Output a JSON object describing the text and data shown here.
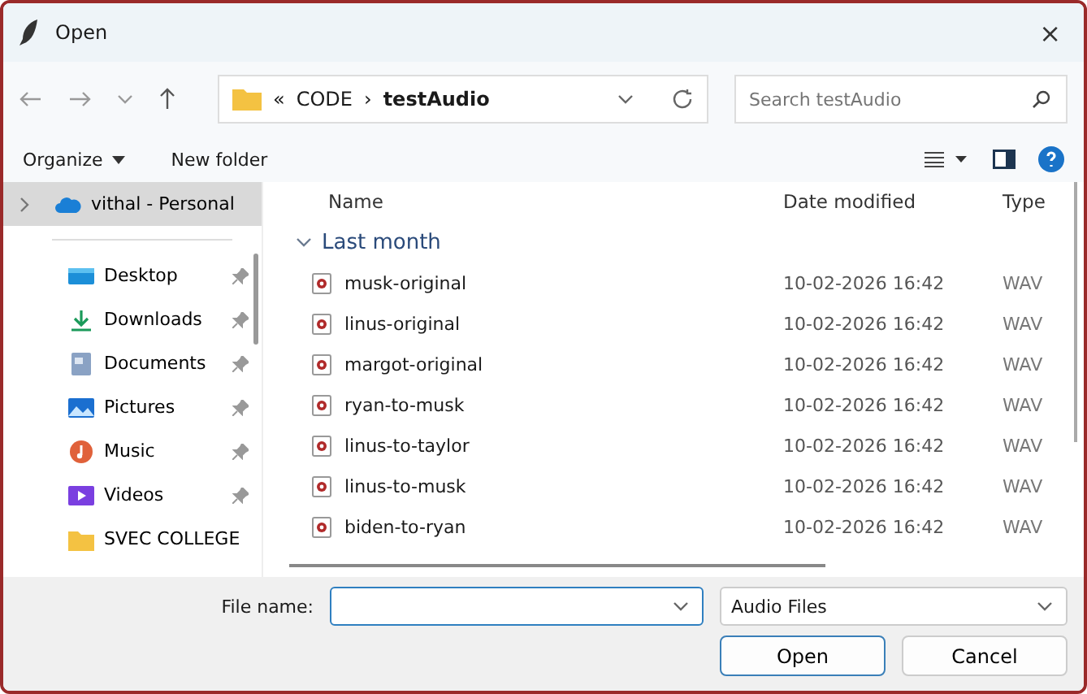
{
  "window": {
    "title": "Open",
    "close": "×"
  },
  "address": {
    "crumbs": [
      "«",
      "CODE",
      "›",
      "testAudio"
    ]
  },
  "search": {
    "placeholder": "Search testAudio"
  },
  "toolbar": {
    "organize": "Organize",
    "new_folder": "New folder"
  },
  "sidebar": {
    "items": [
      {
        "label": "vithal - Personal",
        "kind": "cloud",
        "selected": true,
        "pinned": false
      },
      {
        "label": "Desktop",
        "kind": "desktop",
        "selected": false,
        "pinned": true
      },
      {
        "label": "Downloads",
        "kind": "downloads",
        "selected": false,
        "pinned": true
      },
      {
        "label": "Documents",
        "kind": "documents",
        "selected": false,
        "pinned": true
      },
      {
        "label": "Pictures",
        "kind": "pictures",
        "selected": false,
        "pinned": true
      },
      {
        "label": "Music",
        "kind": "music",
        "selected": false,
        "pinned": true
      },
      {
        "label": "Videos",
        "kind": "videos",
        "selected": false,
        "pinned": true
      },
      {
        "label": "SVEC COLLEGE",
        "kind": "folder",
        "selected": false,
        "pinned": false
      }
    ]
  },
  "table": {
    "columns": [
      "Name",
      "Date modified",
      "Type"
    ],
    "group": {
      "label": "Last month",
      "expanded": true
    },
    "rows": [
      {
        "name": "musk-original",
        "date": "10-02-2026 16:42",
        "type": "WAV"
      },
      {
        "name": "linus-original",
        "date": "10-02-2026 16:42",
        "type": "WAV"
      },
      {
        "name": "margot-original",
        "date": "10-02-2026 16:42",
        "type": "WAV"
      },
      {
        "name": "ryan-to-musk",
        "date": "10-02-2026 16:42",
        "type": "WAV"
      },
      {
        "name": "linus-to-taylor",
        "date": "10-02-2026 16:42",
        "type": "WAV"
      },
      {
        "name": "linus-to-musk",
        "date": "10-02-2026 16:42",
        "type": "WAV"
      },
      {
        "name": "biden-to-ryan",
        "date": "10-02-2026 16:42",
        "type": "WAV"
      }
    ]
  },
  "footer": {
    "file_name_label": "File name:",
    "file_type": "Audio Files",
    "buttons": [
      "Open",
      "Cancel"
    ]
  }
}
